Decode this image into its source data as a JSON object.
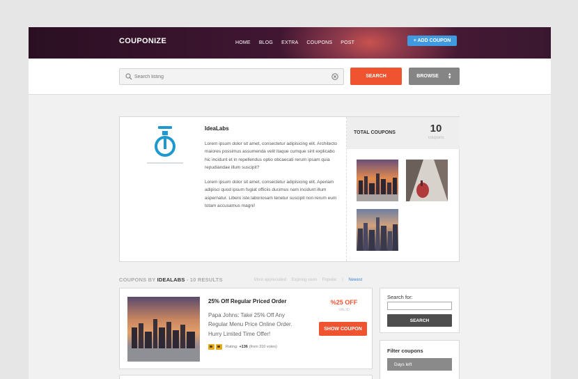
{
  "header": {
    "logo": "COUPONIZE",
    "nav": [
      "HOME",
      "BLOG",
      "EXTRA",
      "COUPONS",
      "POST"
    ],
    "add_coupon_label": "+ ADD COUPON"
  },
  "search": {
    "placeholder": "Search listing",
    "search_label": "SEARCH",
    "browse_label": "BROWSE"
  },
  "company": {
    "name": "IdeaLabs",
    "paragraph_1": "Lorem ipsum dolor sit amet, consectetur adipisicing elit. Architecto maiores possimus assumenda velit itaque cumque sint explicabo hic incidunt et in repellendus optio obcaecati rerum ipsam quia repudiandae illum suscipit?",
    "paragraph_2": "Lorem ipsum dolor sit amet, consectetur adipisicing elit. Aperiam adipisci quod ipsum fugiat officiis ducimus nam incidunt illum aspernatur. Libero iste laboriosam tenetur suscipit non rerum eum totam accusamus magni!",
    "total_label": "TOTAL COUPONS",
    "total_count": "10",
    "total_unit": "coupons",
    "thumbnails": [
      "city-sunset-thumbnail",
      "street-with-red-bag-thumbnail",
      "city-skyline-dusk-thumbnail"
    ]
  },
  "results": {
    "prefix": "COUPONS",
    "by": " BY ",
    "company": "IDEALABS",
    "count": " - 10 RESULTS",
    "sorts": [
      "Most appreciated",
      "Expiring soon",
      "Popular"
    ],
    "separator": "|",
    "active_sort": "Newest"
  },
  "coupon": {
    "title": "25% Off Regular Priced Order",
    "description": "Papa Johns: Take 25% Off Any Regular Menu Price Online Order. Hurry Limited Time Offer!",
    "rating_label": "Rating:",
    "rating_value": "+136",
    "rating_votes": "(from 310 votes)",
    "price": "%25 OFF",
    "valid": "VALID",
    "show_label": "SHOW COUPON"
  },
  "sidebar": {
    "search_for_label": "Search for:",
    "search_button": "SEARCH",
    "filter_title": "Filter coupons",
    "filter_option": "Days left"
  },
  "colors": {
    "accent": "#f0532f",
    "link": "#3f86d6",
    "add_button": "#3f9ae0"
  }
}
